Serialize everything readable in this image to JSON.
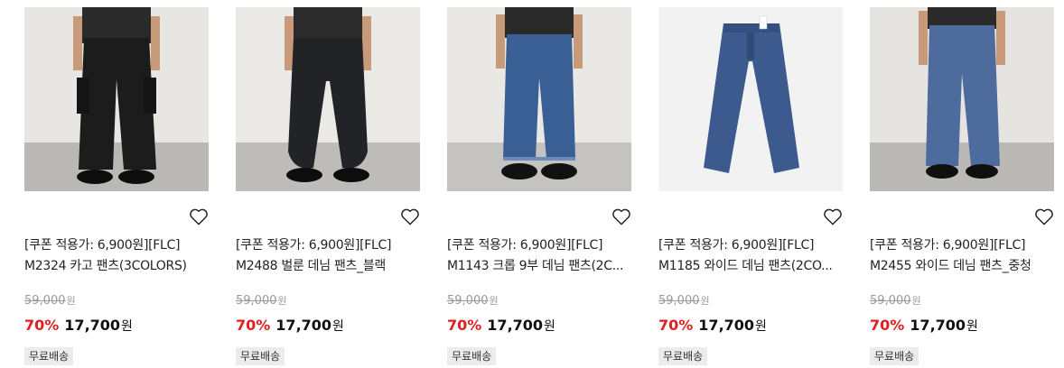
{
  "products": [
    {
      "title": "[쿠폰 적용가: 6,900원][FLC] M2324 카고 팬츠(3COLORS)",
      "original_price": "59,000",
      "original_unit": "원",
      "discount": "70%",
      "price": "17,700",
      "price_unit": "원",
      "badge": "무료배송",
      "image": "model-black-cargo-pants",
      "pants_color": "#1c1c1c"
    },
    {
      "title": "[쿠폰 적용가: 6,900원][FLC] M2488 벌룬 데님 팬츠_블랙",
      "original_price": "59,000",
      "original_unit": "원",
      "discount": "70%",
      "price": "17,700",
      "price_unit": "원",
      "badge": "무료배송",
      "image": "model-black-balloon-denim",
      "pants_color": "#222326"
    },
    {
      "title": "[쿠폰 적용가: 6,900원][FLC] M1143 크롭 9부 데님 팬츠(2C...",
      "original_price": "59,000",
      "original_unit": "원",
      "discount": "70%",
      "price": "17,700",
      "price_unit": "원",
      "badge": "무료배송",
      "image": "model-blue-cropped-denim",
      "pants_color": "#3a5f95"
    },
    {
      "title": "[쿠폰 적용가: 6,900원][FLC] M1185 와이드 데님 팬츠(2CO...",
      "original_price": "59,000",
      "original_unit": "원",
      "discount": "70%",
      "price": "17,700",
      "price_unit": "원",
      "badge": "무료배송",
      "image": "flatlay-wide-denim",
      "pants_color": "#3c5a8e"
    },
    {
      "title": "[쿠폰 적용가: 6,900원][FLC] M2455 와이드 데님 팬츠_중청",
      "original_price": "59,000",
      "original_unit": "원",
      "discount": "70%",
      "price": "17,700",
      "price_unit": "원",
      "badge": "무료배송",
      "image": "model-mid-blue-wide-denim",
      "pants_color": "#4d6b9c"
    }
  ],
  "colors": {
    "discount": "#e02020",
    "muted": "#999999",
    "badge_bg": "#ececec"
  }
}
